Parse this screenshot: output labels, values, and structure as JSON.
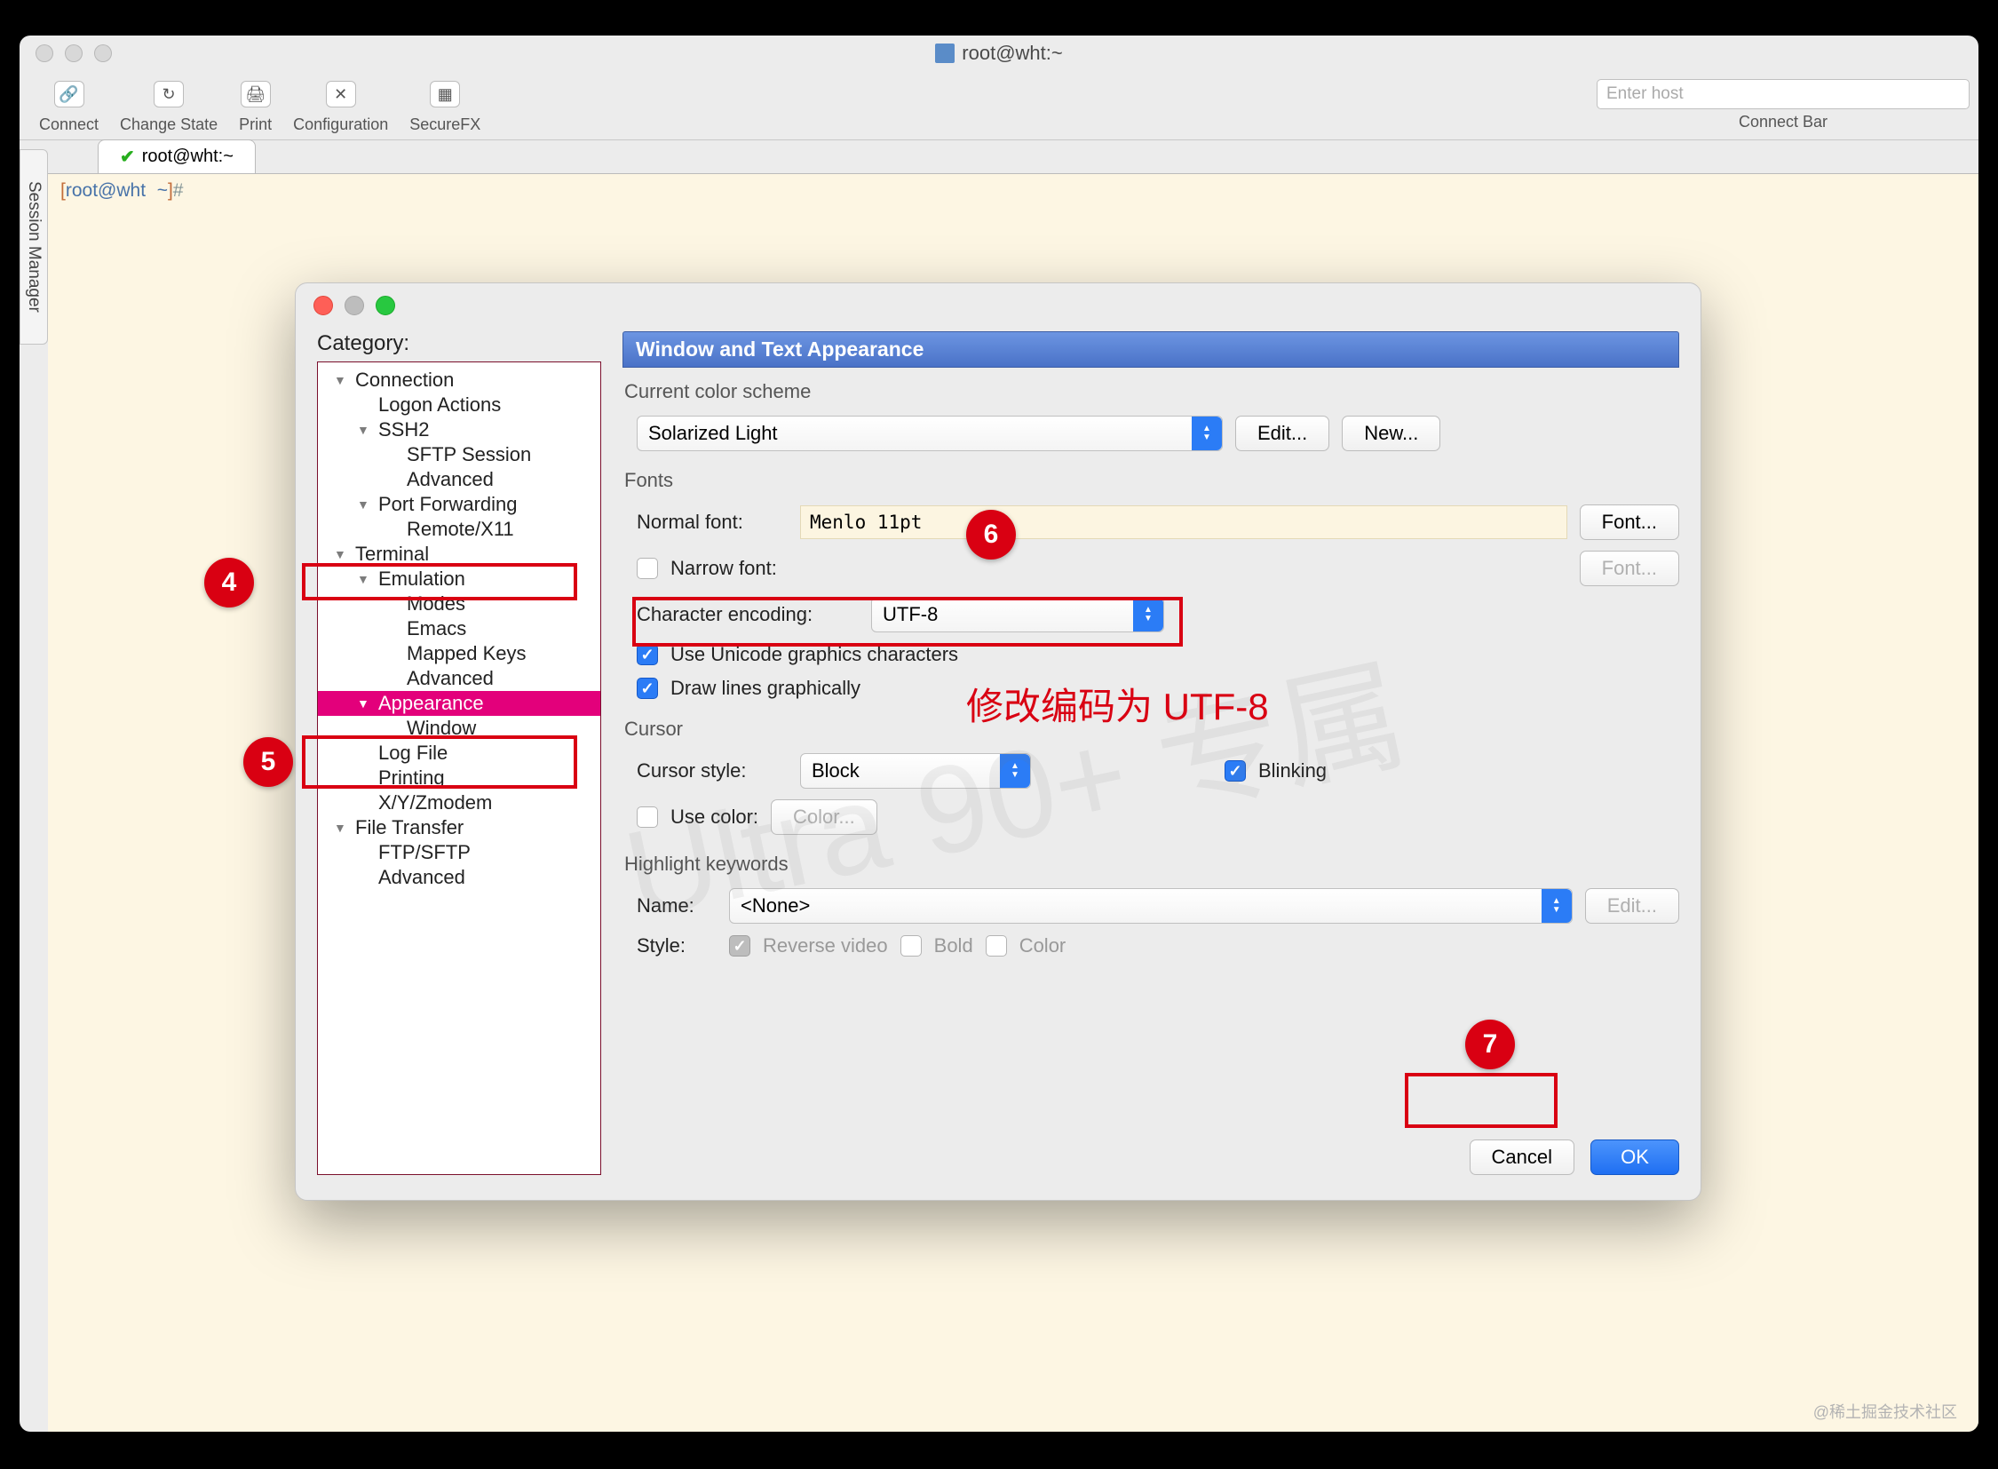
{
  "window": {
    "title": "root@wht:~"
  },
  "toolbar": {
    "connect": "Connect",
    "changeState": "Change State",
    "print": "Print",
    "configuration": "Configuration",
    "securefx": "SecureFX",
    "connectBar": "Connect Bar",
    "enterHostPlaceholder": "Enter host"
  },
  "sessionManagerLabel": "Session Manager",
  "tab": {
    "label": "root@wht:~"
  },
  "terminal": {
    "line1": "[root@wht ~]#"
  },
  "settings": {
    "categoryLabel": "Category:",
    "tree": {
      "connection": "Connection",
      "logonActions": "Logon Actions",
      "ssh2": "SSH2",
      "sftpSession": "SFTP Session",
      "advanced1": "Advanced",
      "portForwarding": "Port Forwarding",
      "remoteX11": "Remote/X11",
      "terminal": "Terminal",
      "emulation": "Emulation",
      "modes": "Modes",
      "emacs": "Emacs",
      "mappedKeys": "Mapped Keys",
      "advanced2": "Advanced",
      "appearance": "Appearance",
      "window": "Window",
      "logFile": "Log File",
      "printing": "Printing",
      "xyzmodem": "X/Y/Zmodem",
      "fileTransfer": "File Transfer",
      "ftpSftp": "FTP/SFTP",
      "advanced3": "Advanced"
    },
    "paneTitle": "Window and Text Appearance",
    "sections": {
      "colorScheme": "Current color scheme",
      "fonts": "Fonts",
      "cursor": "Cursor",
      "highlight": "Highlight keywords"
    },
    "labels": {
      "normalFont": "Normal font:",
      "narrowFont": "Narrow font:",
      "charEncoding": "Character encoding:",
      "useUnicode": "Use Unicode graphics characters",
      "drawLines": "Draw lines graphically",
      "cursorStyle": "Cursor style:",
      "blinking": "Blinking",
      "useColor": "Use color:",
      "name": "Name:",
      "style": "Style:",
      "reverseVideo": "Reverse video",
      "bold": "Bold",
      "color": "Color"
    },
    "values": {
      "colorScheme": "Solarized Light",
      "normalFont": "Menlo 11pt",
      "charEncoding": "UTF-8",
      "cursorStyle": "Block",
      "highlightName": "<None>"
    },
    "buttons": {
      "edit": "Edit...",
      "new": "New...",
      "font": "Font...",
      "color": "Color...",
      "ok": "OK",
      "cancel": "Cancel"
    }
  },
  "annotations": {
    "n4": "4",
    "n5": "5",
    "n6": "6",
    "n7": "7",
    "redText": "修改编码为 UTF-8"
  },
  "credit": "@稀土掘金技术社区"
}
